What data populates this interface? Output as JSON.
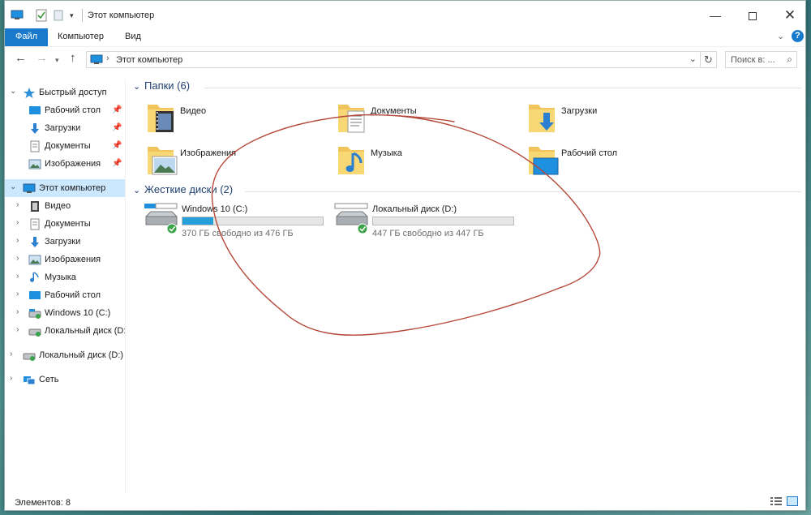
{
  "window": {
    "title": "Этот компьютер"
  },
  "ribbon": {
    "file_tab": "Файл",
    "computer_tab": "Компьютер",
    "view_tab": "Вид",
    "help": "?"
  },
  "address": {
    "path": "Этот компьютер",
    "search_placeholder": "Поиск в: ..."
  },
  "sidebar": {
    "quick_access": {
      "label": "Быстрый доступ",
      "items": [
        {
          "label": "Рабочий стол",
          "icon": "desktop-icon"
        },
        {
          "label": "Загрузки",
          "icon": "downloads-icon"
        },
        {
          "label": "Документы",
          "icon": "documents-icon"
        },
        {
          "label": "Изображения",
          "icon": "pictures-icon"
        }
      ]
    },
    "this_pc": {
      "label": "Этот компьютер",
      "items": [
        {
          "label": "Видео",
          "icon": "video-icon"
        },
        {
          "label": "Документы",
          "icon": "documents-icon"
        },
        {
          "label": "Загрузки",
          "icon": "downloads-icon"
        },
        {
          "label": "Изображения",
          "icon": "pictures-icon"
        },
        {
          "label": "Музыка",
          "icon": "music-icon"
        },
        {
          "label": "Рабочий стол",
          "icon": "desktop-icon"
        },
        {
          "label": "Windows 10 (C:)",
          "icon": "drive-icon"
        },
        {
          "label": "Локальный диск (D:)",
          "icon": "drive-icon"
        }
      ]
    },
    "local_disk": {
      "label": "Локальный диск (D:)"
    },
    "network": {
      "label": "Сеть"
    }
  },
  "folders_group": {
    "title": "Папки (6)",
    "items": [
      {
        "label": "Видео",
        "icon": "video-folder-icon"
      },
      {
        "label": "Документы",
        "icon": "documents-folder-icon"
      },
      {
        "label": "Загрузки",
        "icon": "downloads-folder-icon"
      },
      {
        "label": "Изображения",
        "icon": "pictures-folder-icon"
      },
      {
        "label": "Музыка",
        "icon": "music-folder-icon"
      },
      {
        "label": "Рабочий стол",
        "icon": "desktop-folder-icon"
      }
    ]
  },
  "drives_group": {
    "title": "Жесткие диски (2)",
    "items": [
      {
        "label": "Windows 10 (C:)",
        "free_text": "370 ГБ свободно из 476 ГБ",
        "used_fraction": 0.22
      },
      {
        "label": "Локальный диск (D:)",
        "free_text": "447 ГБ свободно из 447 ГБ",
        "used_fraction": 0.0
      }
    ]
  },
  "status": {
    "items_count": "Элементов: 8"
  },
  "colors": {
    "accent": "#1979ca",
    "selection": "#cce8ff",
    "drive_bar": "#26a0da",
    "annotation": "#b5483a"
  }
}
